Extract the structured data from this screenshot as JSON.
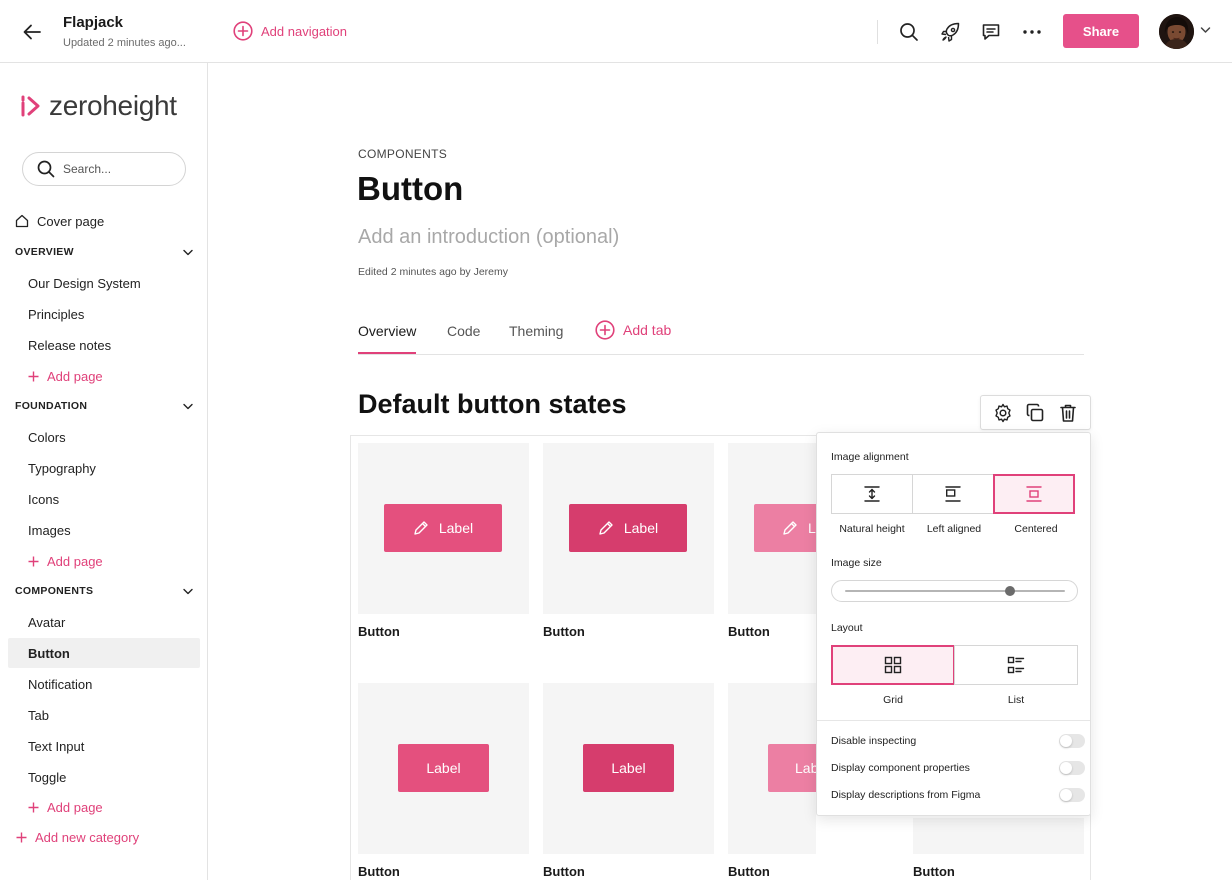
{
  "header": {
    "project_title": "Flapjack",
    "updated": "Updated 2 minutes ago...",
    "add_navigation": "Add navigation",
    "share_label": "Share"
  },
  "sidebar": {
    "logo_text": "zeroheight",
    "search_placeholder": "Search...",
    "cover_page": "Cover page",
    "categories": [
      {
        "name": "OVERVIEW",
        "pages": [
          "Our Design System",
          "Principles",
          "Release notes"
        ],
        "add_page": "Add page"
      },
      {
        "name": "FOUNDATION",
        "pages": [
          "Colors",
          "Typography",
          "Icons",
          "Images"
        ],
        "add_page": "Add page"
      },
      {
        "name": "COMPONENTS",
        "pages": [
          "Avatar",
          "Button",
          "Notification",
          "Tab",
          "Text Input",
          "Toggle"
        ],
        "add_page": "Add page",
        "active": "Button"
      }
    ],
    "add_category": "Add new category"
  },
  "main": {
    "eyebrow": "COMPONENTS",
    "title": "Button",
    "intro_placeholder": "Add an introduction (optional)",
    "edited": "Edited 2 minutes ago by Jeremy",
    "tabs": [
      "Overview",
      "Code",
      "Theming"
    ],
    "active_tab": "Overview",
    "add_tab": "Add tab",
    "section_title": "Default button states",
    "tiles": [
      {
        "caption": "Button",
        "button_label": "Label",
        "color": "#e4507e"
      },
      {
        "caption": "Button",
        "button_label": "Label",
        "color": "#d63d6d"
      },
      {
        "caption": "Button",
        "button_label": "Label",
        "color": "#ec7fa3"
      },
      {
        "caption": "Button",
        "button_label": "Label",
        "color": "#e4507e"
      },
      {
        "caption": "Button",
        "button_label": "Label",
        "color": "#d63d6d"
      },
      {
        "caption": "Button",
        "button_label": "Label",
        "color": "#ec7fa3"
      },
      {
        "caption": "Button"
      }
    ]
  },
  "settings_panel": {
    "image_alignment_label": "Image alignment",
    "alignment_options": [
      "Natural height",
      "Left aligned",
      "Centered"
    ],
    "selected_alignment": "Centered",
    "image_size_label": "Image size",
    "image_size_value": 0.75,
    "layout_label": "Layout",
    "layout_options": [
      "Grid",
      "List"
    ],
    "selected_layout": "Grid",
    "toggles": [
      {
        "label": "Disable inspecting",
        "on": false
      },
      {
        "label": "Display component properties",
        "on": false
      },
      {
        "label": "Display descriptions from Figma",
        "on": false
      }
    ]
  },
  "colors": {
    "accent": "#e0417a",
    "share_button": "#e6508a"
  }
}
